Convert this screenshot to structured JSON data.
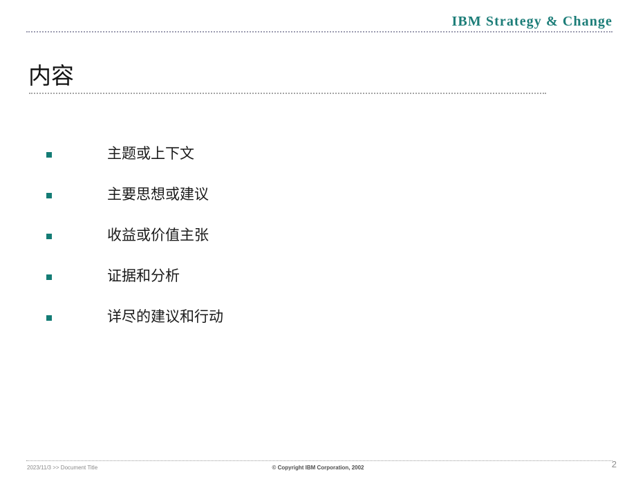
{
  "slide": {
    "background_color": "#ffffff",
    "header": {
      "brand": "IBM Strategy & Change",
      "brand_color": "#1c7d78",
      "rule_color": "#9b9bb0"
    },
    "title": {
      "text": "内容",
      "color": "#141414",
      "rule_color": "#a3a3a3"
    },
    "bullets": {
      "marker_color": "#147c75",
      "items": [
        {
          "label": "主题或上下文"
        },
        {
          "label": "主要思想或建议"
        },
        {
          "label": "收益或价值主张"
        },
        {
          "label": "证据和分析"
        },
        {
          "label": "详尽的建议和行动"
        }
      ]
    },
    "footer": {
      "left": "2023/11/3  >> Document Title",
      "center": "© Copyright IBM Corporation, 2002",
      "page_number": "2",
      "rule_color": "#9a9a9a"
    }
  }
}
